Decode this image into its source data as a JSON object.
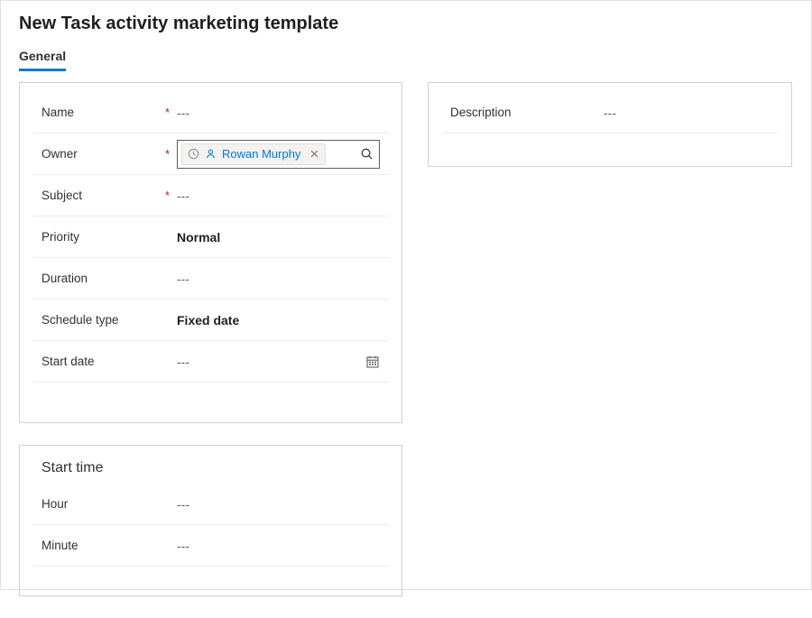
{
  "pageTitle": "New Task activity marketing template",
  "tabs": {
    "general": "General"
  },
  "empty": "---",
  "requiredMark": "*",
  "main": {
    "name": {
      "label": "Name"
    },
    "owner": {
      "label": "Owner",
      "value": "Rowan Murphy"
    },
    "subject": {
      "label": "Subject"
    },
    "priority": {
      "label": "Priority",
      "value": "Normal"
    },
    "duration": {
      "label": "Duration"
    },
    "scheduleType": {
      "label": "Schedule type",
      "value": "Fixed date"
    },
    "startDate": {
      "label": "Start date"
    }
  },
  "startTime": {
    "title": "Start time",
    "hour": {
      "label": "Hour"
    },
    "minute": {
      "label": "Minute"
    }
  },
  "right": {
    "description": {
      "label": "Description"
    }
  }
}
